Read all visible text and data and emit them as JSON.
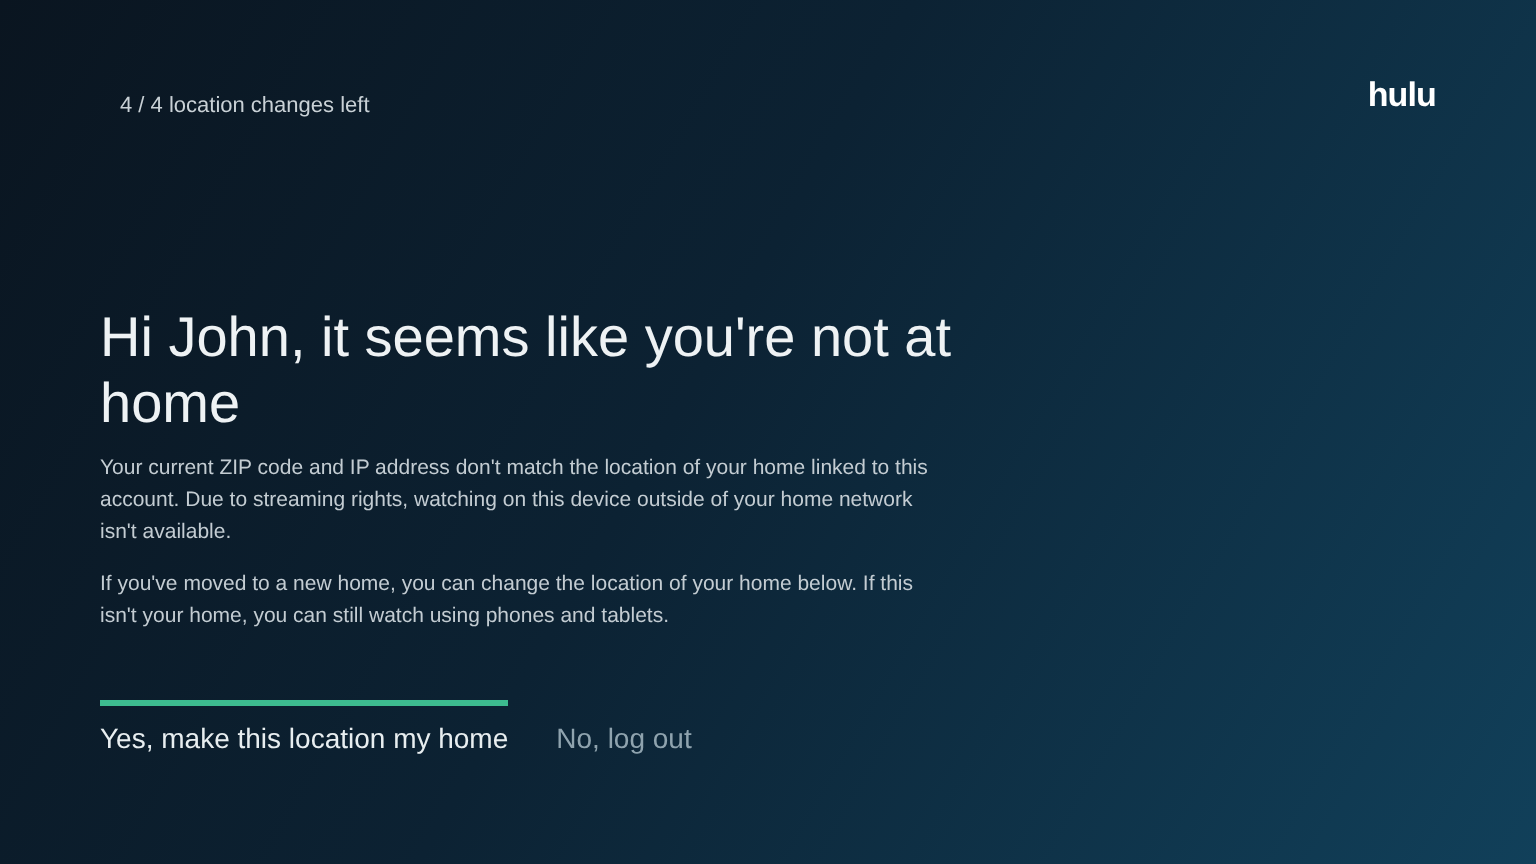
{
  "counter": "4 / 4 location changes left",
  "logo": "hulu",
  "heading": "Hi John, it seems like you're not at home",
  "paragraphs": [
    "Your current ZIP code and IP address don't match the location of your home linked to this account. Due to streaming rights, watching on this device outside of your home network isn't available.",
    "If you've moved to a new home, you can change the location of your home below. If this isn't your home, you can still watch using phones and tablets."
  ],
  "buttons": [
    {
      "label": "Yes, make this location my home",
      "selected": true
    },
    {
      "label": "No, log out",
      "selected": false
    }
  ]
}
